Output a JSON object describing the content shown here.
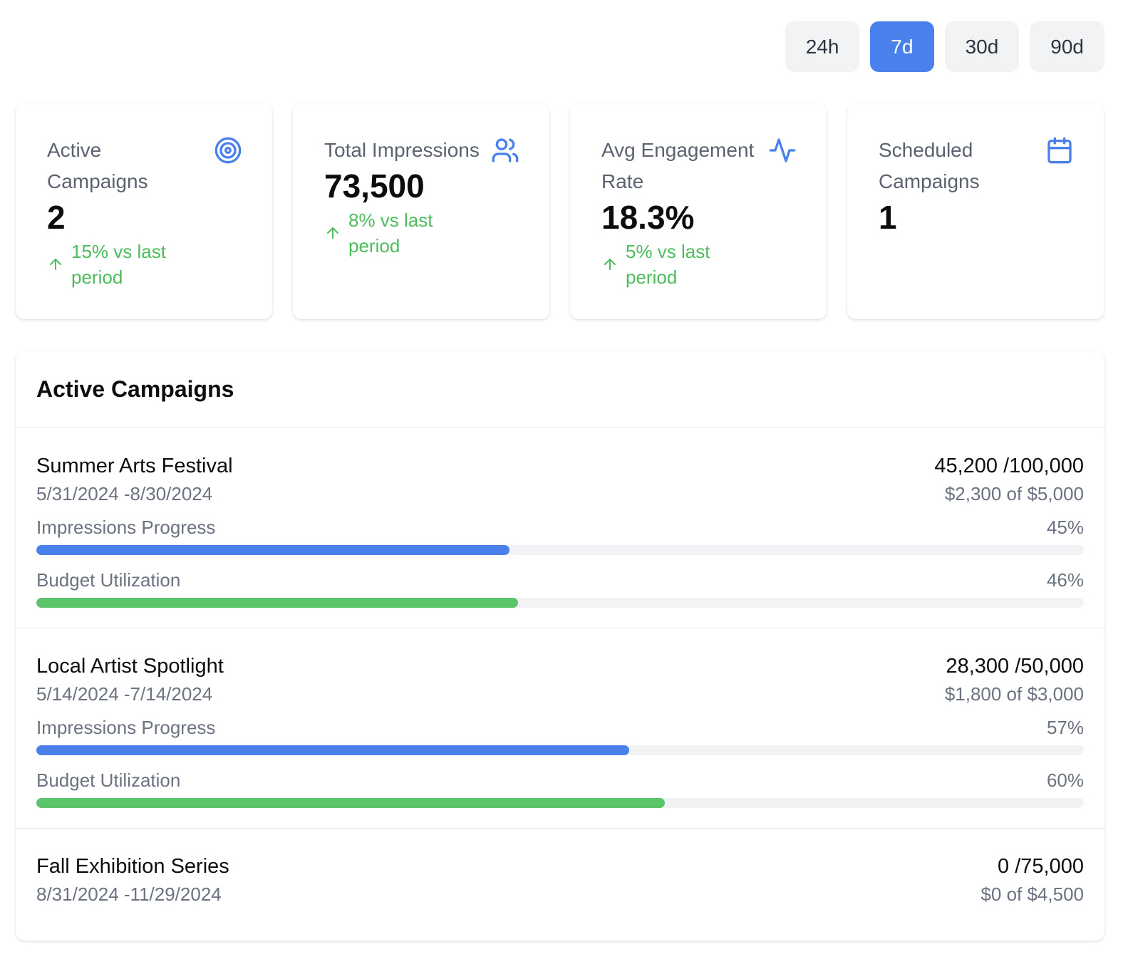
{
  "range": {
    "options": [
      {
        "label": "24h",
        "active": false
      },
      {
        "label": "7d",
        "active": true
      },
      {
        "label": "30d",
        "active": false
      },
      {
        "label": "90d",
        "active": false
      }
    ]
  },
  "stats": [
    {
      "label": "Active Campaigns",
      "value": "2",
      "delta": "15% vs last period",
      "icon": "target-icon"
    },
    {
      "label": "Total Impressions",
      "value": "73,500",
      "delta": "8% vs last period",
      "icon": "users-icon"
    },
    {
      "label": "Avg Engagement Rate",
      "value": "18.3%",
      "delta": "5% vs last period",
      "icon": "activity-icon"
    },
    {
      "label": "Scheduled Campaigns",
      "value": "1",
      "delta": "",
      "icon": "calendar-icon"
    }
  ],
  "panel": {
    "title": "Active Campaigns",
    "impressions_label": "Impressions Progress",
    "budget_label": "Budget Utilization",
    "campaigns": [
      {
        "name": "Summer Arts Festival",
        "dates": "5/31/2024 -8/30/2024",
        "impressions": "45,200 /100,000",
        "budget": "$2,300 of $5,000",
        "impressions_pct": "45%",
        "budget_pct": "46%",
        "impressions_progress": 0.452,
        "budget_progress": 0.46
      },
      {
        "name": "Local Artist Spotlight",
        "dates": "5/14/2024 -7/14/2024",
        "impressions": "28,300 /50,000",
        "budget": "$1,800 of $3,000",
        "impressions_pct": "57%",
        "budget_pct": "60%",
        "impressions_progress": 0.566,
        "budget_progress": 0.6
      },
      {
        "name": "Fall Exhibition Series",
        "dates": "8/31/2024 -11/29/2024",
        "impressions": "0 /75,000",
        "budget": "$0 of $4,500"
      }
    ]
  },
  "colors": {
    "accent": "#4a80ec",
    "positive": "#4cbc5c",
    "budget_bar": "#5cc46a"
  }
}
